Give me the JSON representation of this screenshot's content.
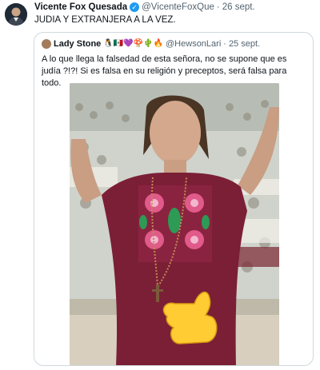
{
  "tweet": {
    "author_name": "Vicente Fox Quesada",
    "handle": "@VicenteFoxQue",
    "separator": "·",
    "date": "26 sept.",
    "text": "JUDIA Y EXTRANJERA A LA VEZ."
  },
  "quoted": {
    "author_name": "Lady Stone",
    "name_emojis": "🐧🇲🇽💜🍄🌵🔥",
    "handle": "@HewsonLari",
    "separator": "·",
    "date": "25 sept.",
    "text": "A lo que llega la falsedad de esta señora, no se supone que es judía ?!?! Si es falsa en su religión y preceptos, será falsa para todo."
  },
  "colors": {
    "verified": "#1d9bf0",
    "border": "#cfd9de",
    "muted": "#536471",
    "dress": "#7b1f36"
  },
  "icons": {
    "verified": "verified-badge-icon",
    "pointing_hand": "pointing-hand-emoji"
  }
}
